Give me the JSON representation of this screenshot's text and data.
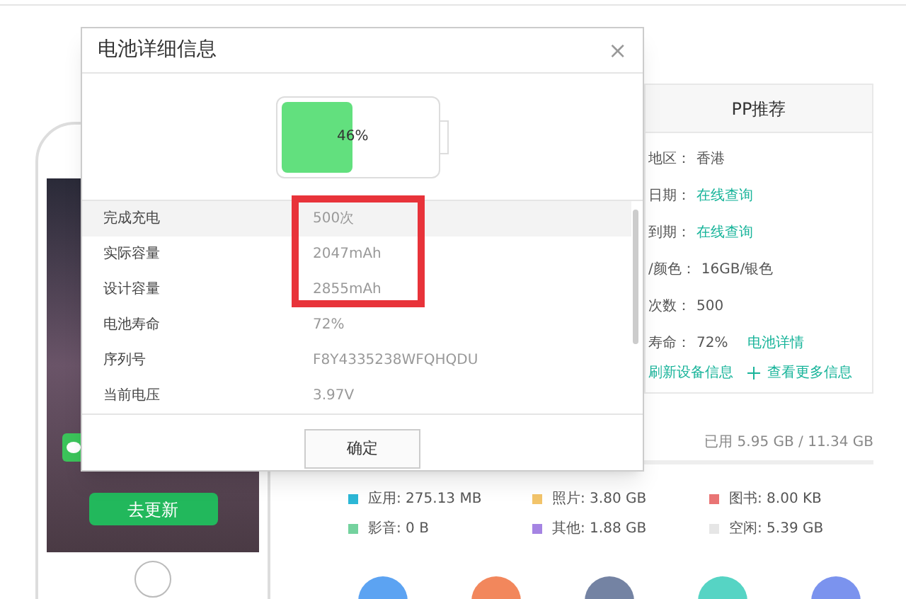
{
  "phone": {
    "update_button": "去更新"
  },
  "recommend": {
    "title": "PP推荐",
    "rows": [
      {
        "label": "地区：",
        "value": "香港",
        "kind": "text"
      },
      {
        "label": "日期：",
        "value": "在线查询",
        "kind": "link"
      },
      {
        "label": "到期：",
        "value": "在线查询",
        "kind": "link"
      },
      {
        "label": "/颜色：",
        "value": "16GB/银色",
        "kind": "text"
      },
      {
        "label": "次数：",
        "value": "500",
        "kind": "text"
      },
      {
        "label": "寿命：",
        "value": "72%",
        "kind": "text",
        "link": "电池详情"
      }
    ],
    "actions": [
      "刷新设备信息",
      "查看更多信息"
    ]
  },
  "storage": {
    "used": "已用 5.95 GB / 11.34 GB",
    "legend": [
      {
        "label": "应用: 275.13 MB",
        "color": "#2cb7d6"
      },
      {
        "label": "照片: 3.80 GB",
        "color": "#f2c46a"
      },
      {
        "label": "图书: 8.00 KB",
        "color": "#e97474"
      },
      {
        "label": "影音: 0 B",
        "color": "#74d29e"
      },
      {
        "label": "其他: 1.88 GB",
        "color": "#a584e3"
      },
      {
        "label": "空闲: 5.39 GB",
        "color": "#e6e6e6"
      }
    ]
  },
  "apps": [
    {
      "color": "#5ca3f2"
    },
    {
      "color": "#f2875c"
    },
    {
      "color": "#7483a3"
    },
    {
      "color": "#56d4c4"
    },
    {
      "color": "#7b93ee"
    }
  ],
  "dialog": {
    "title": "电池详细信息",
    "close": "×",
    "battery": {
      "level": 0.46,
      "label": "46%"
    },
    "rows": [
      {
        "label": "完成充电",
        "value": "500次",
        "selected": true,
        "outlined": true
      },
      {
        "label": "实际容量",
        "value": "2047mAh",
        "selected": false,
        "outlined": true
      },
      {
        "label": "设计容量",
        "value": "2855mAh",
        "selected": false,
        "outlined": true
      },
      {
        "label": "电池寿命",
        "value": "72%",
        "selected": false,
        "outlined": false
      },
      {
        "label": "序列号",
        "value": "F8Y4335238WFQHQDU",
        "selected": false,
        "outlined": false
      },
      {
        "label": "当前电压",
        "value": "3.97V",
        "selected": false,
        "outlined": false
      }
    ],
    "button": "确定"
  }
}
